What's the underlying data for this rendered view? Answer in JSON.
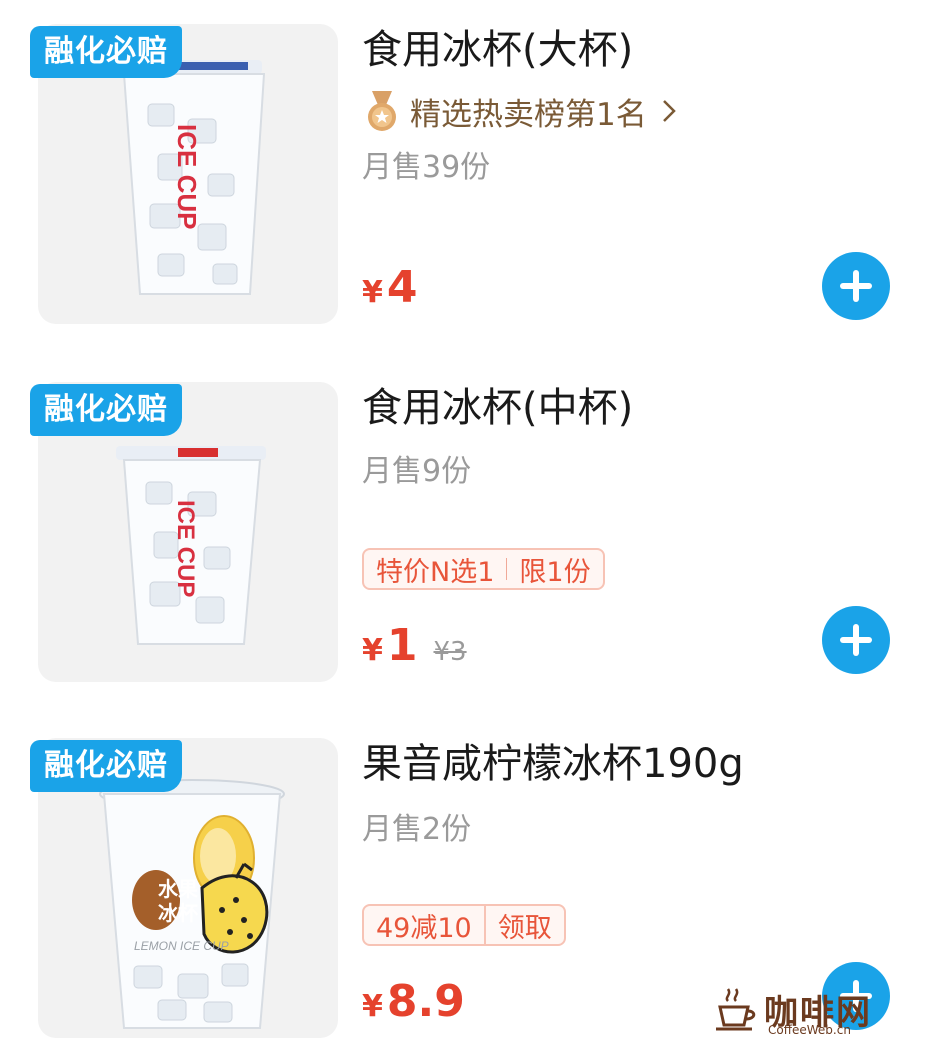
{
  "items": [
    {
      "badge": "融化必赔",
      "title": "食用冰杯(大杯)",
      "rank_label": "精选热卖榜第1名",
      "sold": "月售39份",
      "currency": "¥",
      "price": "4",
      "cup_text": "ICE CUP",
      "lid_color": "#3a5fb0"
    },
    {
      "badge": "融化必赔",
      "title": "食用冰杯(中杯)",
      "sold": "月售9份",
      "promo_left": "特价N选1",
      "promo_right": "限1份",
      "currency": "¥",
      "price": "1",
      "old_price": "¥3",
      "cup_text": "ICE CUP",
      "lid_color": "#d83030"
    },
    {
      "badge": "融化必赔",
      "title": "果音咸柠檬冰杯190g",
      "sold": "月售2份",
      "promo_left": "49减10",
      "promo_right": "领取",
      "currency": "¥",
      "price": "8.9",
      "cup_text_line1": "水果",
      "cup_text_line2": "冰杯",
      "cup_text_small": "LEMON ICE CUP"
    }
  ],
  "watermark": {
    "text": "咖啡网",
    "sub": "CoffeeWeb.cn"
  },
  "colors": {
    "accent": "#1aa3e8",
    "price": "#e5422d",
    "muted": "#9a9a9a"
  }
}
